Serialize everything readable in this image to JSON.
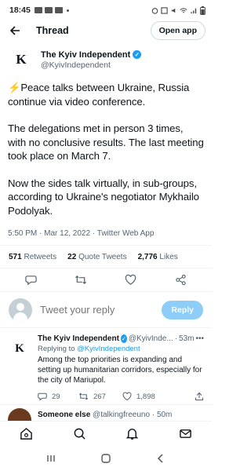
{
  "status_bar": {
    "time": "18:45"
  },
  "header": {
    "title": "Thread",
    "open_app_label": "Open app"
  },
  "tweet": {
    "author_name": "The Kyiv Independent",
    "author_handle": "@KyivIndependent",
    "avatar_letter": "K",
    "paragraph_1": "⚡Peace talks between Ukraine, Russia continue via video conference.",
    "paragraph_2": "The delegations met in person 3 times, with no conclusive results. The last meeting took place on March 7.",
    "paragraph_3": "Now the sides talk virtually, in sub-groups, according to Ukraine's negotiator Mykhailo Podolyak.",
    "meta": "5:50 PM · Mar 12, 2022 · Twitter Web App",
    "retweets_count": "571",
    "retweets_label": "Retweets",
    "quotes_count": "22",
    "quotes_label": "Quote Tweets",
    "likes_count": "2,776",
    "likes_label": "Likes"
  },
  "reply_composer": {
    "placeholder": "Tweet your reply",
    "button_label": "Reply"
  },
  "reply_tweet": {
    "avatar_letter": "K",
    "author_name": "The Kyiv Independent",
    "author_handle": "@KyivInde...",
    "separator": "·",
    "time": "53m",
    "replying_prefix": "Replying to",
    "replying_handle": "@KyivIndependent",
    "text": "Among the top priorities is expanding and setting up humanitarian corridors, especially for the city of Mariupol.",
    "replies": "29",
    "retweets": "267",
    "likes": "1,898"
  },
  "next_tweet": {
    "author_name": "Someone else",
    "author_handle": "@talkingfreeuno",
    "time": "50m"
  },
  "colors": {
    "accent": "#1d9bf0",
    "reply_button": "#8ecdf8",
    "muted": "#536471"
  }
}
